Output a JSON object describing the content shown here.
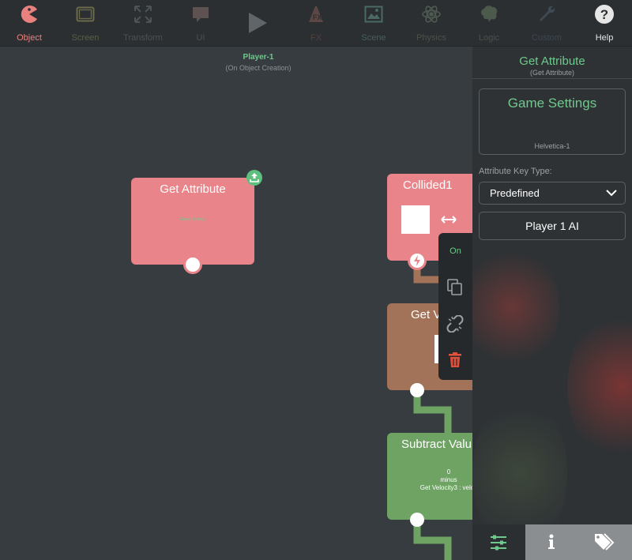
{
  "toolbar": {
    "items": [
      {
        "label": "Object",
        "icon": "pacman-icon",
        "color": "#e9827e"
      },
      {
        "label": "Screen",
        "icon": "tablet-icon",
        "color": "#6b6a4a"
      },
      {
        "label": "Transform",
        "icon": "expand-arrows-icon",
        "color": "#4d5456"
      },
      {
        "label": "UI",
        "icon": "speech-bubble-icon",
        "color": "#5e5253"
      },
      {
        "label": "FX",
        "icon": "fx-icon",
        "color": "#5c4744"
      },
      {
        "label": "Scene",
        "icon": "image-icon",
        "color": "#4a6a62"
      },
      {
        "label": "Physics",
        "icon": "atom-icon",
        "color": "#4f5a50"
      },
      {
        "label": "Logic",
        "icon": "brain-icon",
        "color": "#4c5a4c"
      },
      {
        "label": "Custom",
        "icon": "wrench-icon",
        "color": "#3f4a55"
      },
      {
        "label": "Help",
        "icon": "help-icon",
        "color": "#e6e6e6"
      }
    ],
    "play_icon": "play-icon"
  },
  "canvas": {
    "object_name": "Player-1",
    "event_name": "(On Object Creation)",
    "nodes": {
      "get_attribute": {
        "title": "Get Attribute",
        "detail": "Game Settings",
        "color": "#e9858a"
      },
      "collided": {
        "title": "Collided1",
        "color": "#e9858a"
      },
      "get_velocity": {
        "title": "Get V",
        "color": "#a37359"
      },
      "subtract": {
        "title": "Subtract Valu",
        "line1": "0",
        "line2": "minus",
        "line3": "Get Velocity3 : veloc",
        "color": "#6ea363"
      }
    }
  },
  "context_menu": {
    "on_label": "On",
    "items": [
      "copy-icon",
      "unlink-icon",
      "trash-icon"
    ]
  },
  "panel": {
    "title": "Get Attribute",
    "subtitle": "(Get Attribute)",
    "source_title": "Game Settings",
    "source_font": "Helvetica-1",
    "key_type_label": "Attribute Key Type:",
    "key_type_value": "Predefined",
    "key_value": "Player 1 AI",
    "tabs": [
      {
        "icon": "sliders-icon",
        "active": true
      },
      {
        "icon": "info-icon",
        "active": false
      },
      {
        "icon": "tags-icon",
        "active": false
      }
    ],
    "accent": "#6ec98b"
  }
}
